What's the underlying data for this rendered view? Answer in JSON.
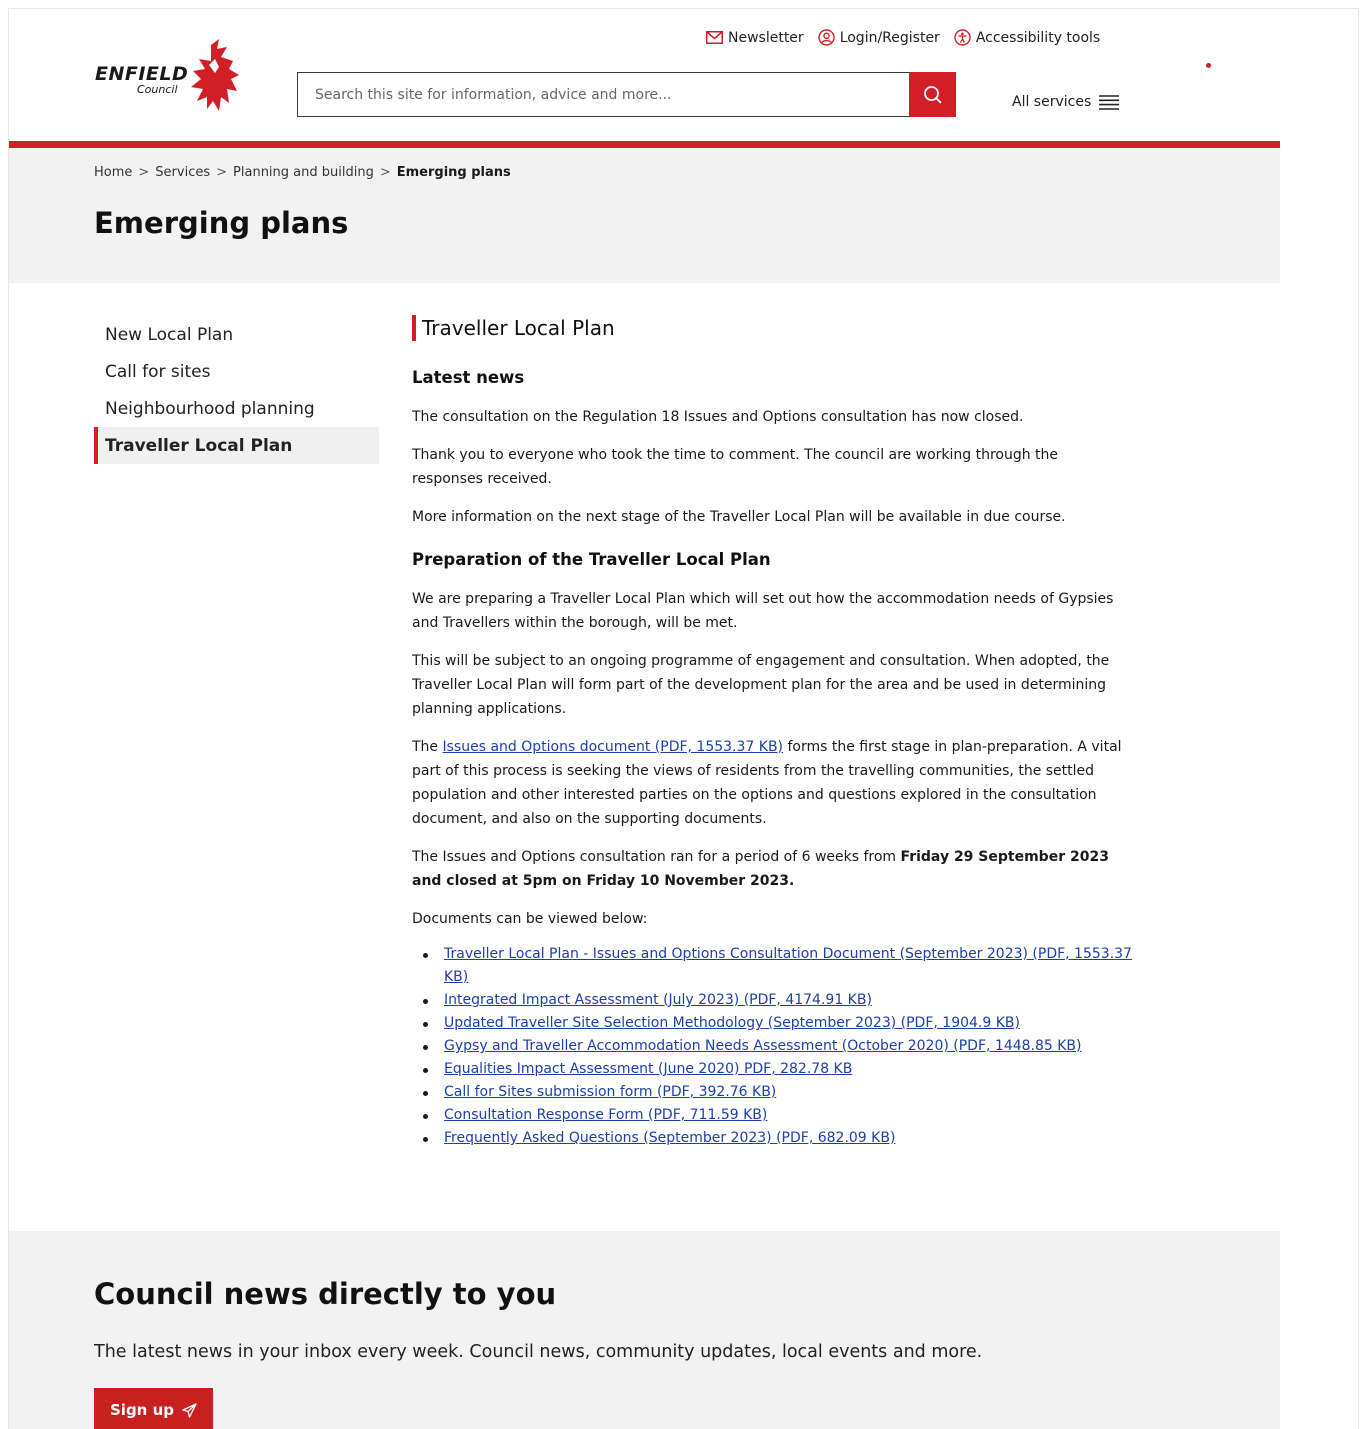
{
  "header": {
    "logo_word": "ENFIELD",
    "logo_sub": "Council",
    "toplinks": {
      "newsletter": "Newsletter",
      "login": "Login/Register",
      "accessibility": "Accessibility tools"
    },
    "search_placeholder": "Search this site for information, advice and more...",
    "all_services": "All services"
  },
  "breadcrumb": {
    "items": [
      "Home",
      "Services",
      "Planning and building"
    ],
    "current": "Emerging plans",
    "separator": ">"
  },
  "page_title": "Emerging plans",
  "sidenav": {
    "items": [
      "New Local Plan",
      "Call for sites",
      "Neighbourhood planning",
      "Traveller Local Plan"
    ]
  },
  "main": {
    "heading": "Traveller Local Plan",
    "latest_news": {
      "heading": "Latest news",
      "p1": "The consultation on the Regulation 18 Issues and Options consultation has now closed.",
      "p2": "Thank you to everyone who took the time to comment. The council are working through the responses received.",
      "p3": "More information on the next stage of the Traveller Local Plan will be available in due course."
    },
    "preparation": {
      "heading": "Preparation of the Traveller Local Plan",
      "p1": "We are preparing a Traveller Local Plan which will set out how the accommodation needs of Gypsies and Travellers within the borough, will be met.",
      "p2": "This will be subject to an ongoing programme of engagement and consultation. When adopted, the Traveller Local Plan will form part of the development plan for the area and be used in determining planning applications.",
      "p3_prefix": "The ",
      "p3_link": "Issues and Options document (PDF, 1553.37 KB)",
      "p3_suffix": " forms the first stage in plan-preparation. A vital part of this process is seeking the views of residents from the travelling communities, the settled population and other interested parties on the options and questions explored in the consultation document, and also on the supporting documents.",
      "p4_prefix": "The Issues and Options consultation ran for a period of 6 weeks from ",
      "p4_bold": "Friday 29 September 2023 and closed at 5pm on Friday 10 November 2023.",
      "p5": "Documents can be viewed below:"
    },
    "documents": [
      "Traveller Local Plan - Issues and Options Consultation Document (September 2023) (PDF, 1553.37 KB)",
      "Integrated Impact Assessment (July 2023) (PDF, 4174.91 KB)",
      "Updated Traveller Site Selection Methodology (September 2023) (PDF, 1904.9 KB)",
      "Gypsy and Traveller Accommodation Needs Assessment (October 2020) (PDF, 1448.85 KB)",
      "Equalities Impact Assessment (June 2020) PDF, 282.78 KB",
      "Call for Sites submission form (PDF, 392.76 KB)",
      "Consultation Response Form (PDF, 711.59 KB)",
      "Frequently Asked Questions (September 2023) (PDF, 682.09 KB)"
    ]
  },
  "footer": {
    "title": "Council news directly to you",
    "description": "The latest news in your inbox every week. Council news, community updates, local events and more.",
    "signup": "Sign up"
  },
  "colors": {
    "brand_red": "#d21e27",
    "link_blue": "#1d3fa8",
    "hero_bg": "#f2f2f2"
  }
}
